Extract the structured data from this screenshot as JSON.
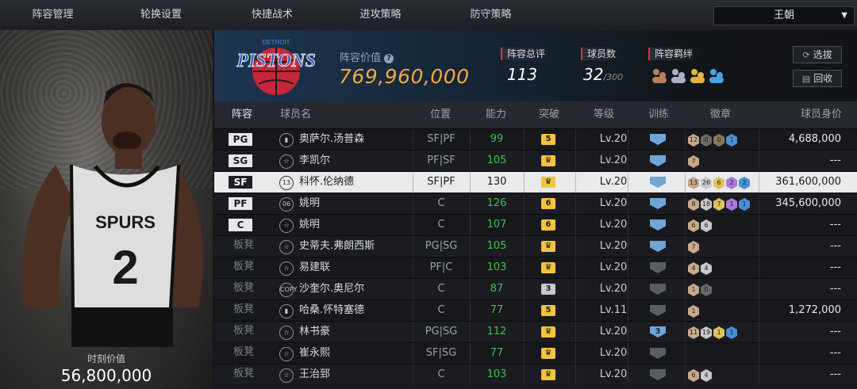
{
  "nav": {
    "tabs": [
      {
        "label": "阵容管理",
        "active": true
      },
      {
        "label": "轮换设置",
        "active": false
      },
      {
        "label": "快捷战术",
        "active": false
      },
      {
        "label": "进攻策略",
        "active": false
      },
      {
        "label": "防守策略",
        "active": false
      }
    ],
    "team_select": "王朝"
  },
  "player_card": {
    "moment_label": "时刻价值",
    "moment_value": "56,800,000",
    "jersey_text": "SPURS",
    "jersey_number": "2"
  },
  "summary": {
    "team_logo_text": "PISTONS",
    "team_logo_small": "DETROIT",
    "value_label": "阵容价值",
    "value": "769,960,000",
    "rating_label": "阵容总评",
    "rating": "113",
    "count_label": "球员数",
    "count": "32",
    "count_max": "/300",
    "bond_label": "阵容羁绊",
    "btn_select": "选拔",
    "btn_recycle": "回收"
  },
  "table": {
    "headers": {
      "lineup": "阵容",
      "name": "球员名",
      "position": "位置",
      "ability": "能力",
      "breakthrough": "突破",
      "level": "等级",
      "training": "训练",
      "badges": "徽章",
      "worth": "球员身价"
    },
    "rows": [
      {
        "slot": "PG",
        "starter": true,
        "type": "stat",
        "name": "奥萨尔.汤普森",
        "pos": "SF|PF",
        "ability": "99",
        "brk": "5",
        "level": "Lv.20",
        "train": "3",
        "badges": [
          [
            "12",
            "#c6a98a"
          ],
          [
            "0",
            "#6d6a66"
          ],
          [
            "0",
            "#8a7b55"
          ],
          [
            "1",
            "#4a8fd6"
          ]
        ],
        "worth": "4,688,000"
      },
      {
        "slot": "SG",
        "starter": true,
        "type": "star",
        "name": "李凯尔",
        "pos": "PF|SF",
        "ability": "105",
        "brk": "crown",
        "level": "Lv.20",
        "train": "3",
        "badges": [
          [
            "7",
            "#c6a98a"
          ]
        ],
        "worth": "---"
      },
      {
        "slot": "SF",
        "starter": true,
        "type": "13",
        "name": "科怀.伦纳德",
        "pos": "SF|PF",
        "ability": "130",
        "brk": "crown",
        "level": "Lv.20",
        "train": "3",
        "badges": [
          [
            "13",
            "#c6a98a"
          ],
          [
            "26",
            "#c9c9c9"
          ],
          [
            "6",
            "#e0c15a"
          ],
          [
            "2",
            "#a97be0"
          ],
          [
            "2",
            "#4a8fd6"
          ]
        ],
        "worth": "361,600,000",
        "highlight": true
      },
      {
        "slot": "PF",
        "starter": true,
        "type": "06",
        "name": "姚明",
        "pos": "C",
        "ability": "126",
        "brk": "6",
        "level": "Lv.20",
        "train": "3",
        "badges": [
          [
            "8",
            "#c6a98a"
          ],
          [
            "18",
            "#c9c9c9"
          ],
          [
            "7",
            "#e0c15a"
          ],
          [
            "1",
            "#a97be0"
          ],
          [
            "1",
            "#4a8fd6"
          ]
        ],
        "worth": "345,600,000"
      },
      {
        "slot": "C",
        "starter": true,
        "type": "star",
        "name": "姚明",
        "pos": "C",
        "ability": "107",
        "brk": "6",
        "level": "Lv.20",
        "train": "3",
        "badges": [
          [
            "6",
            "#c6a98a"
          ],
          [
            "6",
            "#c9c9c9"
          ]
        ],
        "worth": "---"
      },
      {
        "slot": "板凳",
        "starter": false,
        "type": "star",
        "name": "史蒂夫.弗朗西斯",
        "pos": "PG|SG",
        "ability": "105",
        "brk": "crown",
        "level": "Lv.20",
        "train": "3",
        "badges": [
          [
            "7",
            "#c6a98a"
          ]
        ],
        "worth": "---"
      },
      {
        "slot": "板凳",
        "starter": false,
        "type": "star",
        "name": "易建联",
        "pos": "PF|C",
        "ability": "103",
        "brk": "crown",
        "level": "Lv.20",
        "train": "0",
        "badges": [
          [
            "4",
            "#c6a98a"
          ],
          [
            "4",
            "#c9c9c9"
          ]
        ],
        "worth": "---"
      },
      {
        "slot": "板凳",
        "starter": false,
        "type": "COPY",
        "name": "沙奎尔.奥尼尔",
        "pos": "C",
        "ability": "87",
        "brk": "3",
        "brkGrey": true,
        "level": "Lv.20",
        "train": "0",
        "badges": [
          [
            "1",
            "#c6a98a"
          ],
          [
            "0",
            "#6d6a66"
          ]
        ],
        "worth": "---"
      },
      {
        "slot": "板凳",
        "starter": false,
        "type": "stat",
        "name": "哈桑.怀特塞德",
        "pos": "C",
        "ability": "77",
        "brk": "5",
        "level": "Lv.11",
        "train": "0",
        "badges": [
          [
            "1",
            "#c6a98a"
          ]
        ],
        "worth": "1,272,000"
      },
      {
        "slot": "板凳",
        "starter": false,
        "type": "star",
        "name": "林书豪",
        "pos": "PG|SG",
        "ability": "112",
        "brk": "crown",
        "level": "Lv.20",
        "train": "3",
        "trainNum": "3",
        "badges": [
          [
            "11",
            "#c6a98a"
          ],
          [
            "19",
            "#c9c9c9"
          ],
          [
            "1",
            "#e0c15a"
          ],
          [
            "1",
            "#4a8fd6"
          ]
        ],
        "worth": "---"
      },
      {
        "slot": "板凳",
        "starter": false,
        "type": "star",
        "name": "崔永熙",
        "pos": "SF|SG",
        "ability": "77",
        "brk": "crown",
        "level": "Lv.20",
        "train": "0",
        "badges": [],
        "worth": "---"
      },
      {
        "slot": "板凳",
        "starter": false,
        "type": "star",
        "name": "王治郅",
        "pos": "C",
        "ability": "103",
        "brk": "crown",
        "level": "Lv.20",
        "train": "0",
        "badges": [
          [
            "6",
            "#c6a98a"
          ],
          [
            "4",
            "#c9c9c9"
          ]
        ],
        "worth": "---"
      }
    ]
  }
}
